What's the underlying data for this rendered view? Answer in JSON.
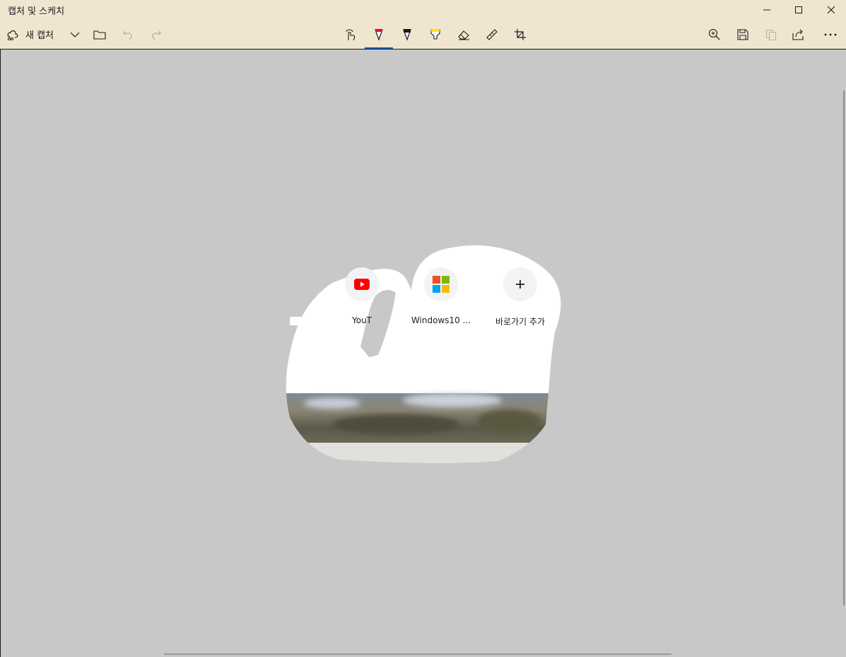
{
  "window": {
    "title": "캡처 및 스케치",
    "controls": [
      "minimize",
      "maximize",
      "close"
    ]
  },
  "toolbar": {
    "new_capture_label": "새 캡처",
    "left_tools": [
      "new-capture-icon",
      "chevron-down-icon",
      "folder-icon",
      "undo-icon",
      "redo-icon"
    ],
    "center_tools": [
      "touch-writing-icon",
      "ballpoint-pen-icon",
      "pencil-icon",
      "highlighter-icon",
      "eraser-icon",
      "ruler-icon",
      "crop-icon"
    ],
    "active_tool": "ballpoint-pen-icon",
    "right_tools": [
      "zoom-icon",
      "save-icon",
      "copy-icon",
      "share-icon",
      "more-icon"
    ],
    "accent_color": "#0063b1"
  },
  "snip": {
    "shortcuts": [
      {
        "label": "YouT",
        "icon": "youtube-icon"
      },
      {
        "label": "Windows10 ...",
        "icon": "windows-logo-icon"
      },
      {
        "label": "바로가기 추가",
        "icon": "plus-icon"
      }
    ]
  },
  "colors": {
    "titlebar": "#f0e6d0",
    "canvas": "#c8c8c8",
    "youtube_red": "#ff0000"
  }
}
